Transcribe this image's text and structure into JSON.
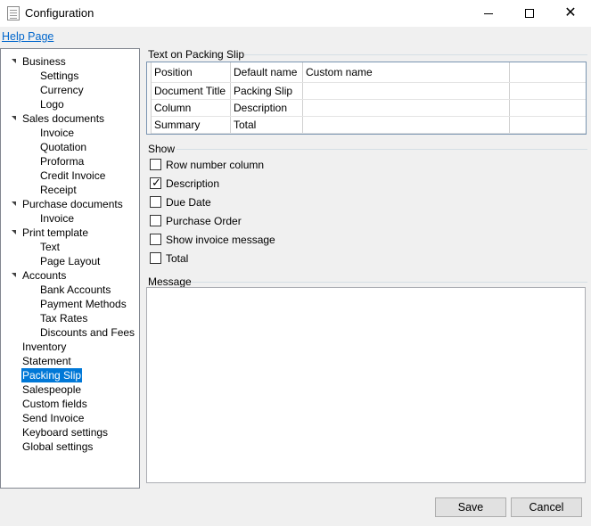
{
  "window": {
    "title": "Configuration",
    "controls": [
      "minimize-icon",
      "maximize-icon",
      "close-icon"
    ]
  },
  "menu": {
    "help_label": "Help Page"
  },
  "tree": {
    "selected": "Packing Slip",
    "items": [
      {
        "label": "Business",
        "level": 0,
        "expanded": true
      },
      {
        "label": "Settings",
        "level": 1
      },
      {
        "label": "Currency",
        "level": 1
      },
      {
        "label": "Logo",
        "level": 1
      },
      {
        "label": "Sales documents",
        "level": 0,
        "expanded": true
      },
      {
        "label": "Invoice",
        "level": 1
      },
      {
        "label": "Quotation",
        "level": 1
      },
      {
        "label": "Proforma",
        "level": 1
      },
      {
        "label": "Credit Invoice",
        "level": 1
      },
      {
        "label": "Receipt",
        "level": 1
      },
      {
        "label": "Purchase documents",
        "level": 0,
        "expanded": true
      },
      {
        "label": "Invoice",
        "level": 1
      },
      {
        "label": "Print template",
        "level": 0,
        "expanded": true
      },
      {
        "label": "Text",
        "level": 1
      },
      {
        "label": "Page Layout",
        "level": 1
      },
      {
        "label": "Accounts",
        "level": 0,
        "expanded": true
      },
      {
        "label": "Bank Accounts",
        "level": 1
      },
      {
        "label": "Payment Methods",
        "level": 1
      },
      {
        "label": "Tax Rates",
        "level": 1
      },
      {
        "label": "Discounts and Fees",
        "level": 1
      },
      {
        "label": "Inventory",
        "level": 0
      },
      {
        "label": "Statement",
        "level": 0
      },
      {
        "label": "Packing Slip",
        "level": 0,
        "selected": true
      },
      {
        "label": "Salespeople",
        "level": 0
      },
      {
        "label": "Custom fields",
        "level": 0
      },
      {
        "label": "Send Invoice",
        "level": 0
      },
      {
        "label": "Keyboard settings",
        "level": 0
      },
      {
        "label": "Global settings",
        "level": 0
      }
    ]
  },
  "text_section": {
    "title": "Text on Packing Slip",
    "columns": [
      "Position",
      "Default name",
      "Custom name",
      ""
    ],
    "rows": [
      [
        "Document Title",
        "Packing Slip",
        "",
        ""
      ],
      [
        "Column",
        "Description",
        "",
        ""
      ],
      [
        "Summary",
        "Total",
        "",
        ""
      ]
    ]
  },
  "show_section": {
    "title": "Show",
    "options": [
      {
        "label": "Row number column",
        "checked": false
      },
      {
        "label": "Description",
        "checked": true
      },
      {
        "label": "Due Date",
        "checked": false
      },
      {
        "label": "Purchase Order",
        "checked": false
      },
      {
        "label": "Show invoice message",
        "checked": false
      },
      {
        "label": "Total",
        "checked": false
      }
    ],
    "check_glyph": "✓"
  },
  "message_section": {
    "title": "Message",
    "value": ""
  },
  "buttons": {
    "save": "Save",
    "cancel": "Cancel"
  },
  "colors": {
    "selection": "#0078d7",
    "link": "#0066cc"
  }
}
